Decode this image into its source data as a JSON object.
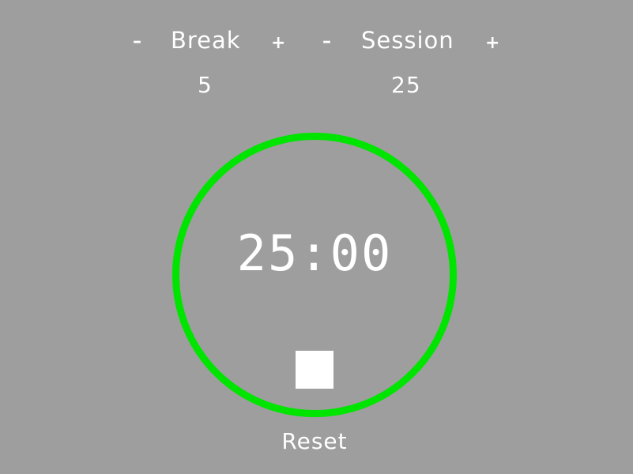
{
  "break": {
    "decrement_label": "–",
    "label": "Break",
    "increment_label": "+",
    "value": "5"
  },
  "session": {
    "decrement_label": "–",
    "label": "Session",
    "increment_label": "+",
    "value": "25"
  },
  "timer": {
    "display": "25:00",
    "ring_color": "#00e500",
    "control_icon": "stop-icon"
  },
  "reset_label": "Reset",
  "colors": {
    "background": "#9e9e9e",
    "text": "#ffffff"
  }
}
